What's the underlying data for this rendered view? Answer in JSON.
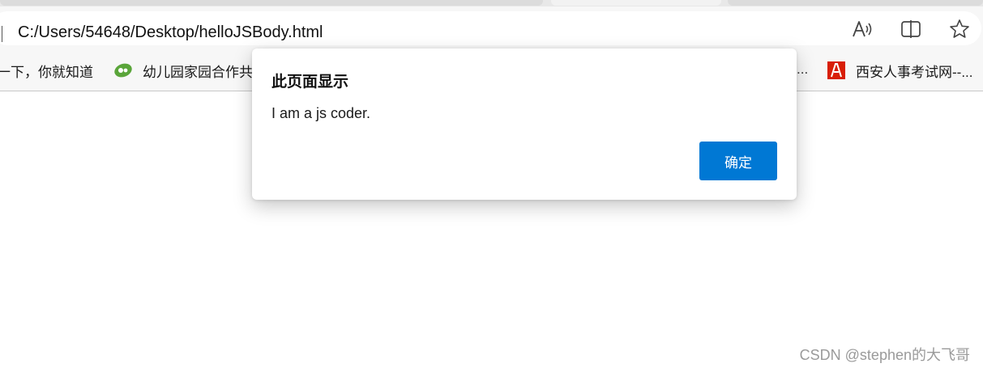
{
  "browser": {
    "address_bar": {
      "url": "C:/Users/54648/Desktop/helloJSBody.html"
    },
    "toolbar_icons": [
      "read-aloud-icon",
      "split-screen-icon",
      "favorite-star-icon"
    ],
    "favorites": [
      {
        "label": "一下，你就知道",
        "icon": "none"
      },
      {
        "label": "幼儿园家园合作共",
        "icon": "leaf-logo-icon"
      },
      {
        "label": "西安人事考试网--...",
        "icon": "red-logo-icon"
      }
    ],
    "favorites_overflow": "..."
  },
  "dialog": {
    "title": "此页面显示",
    "message": "I am a js coder.",
    "ok_label": "确定",
    "accent_color": "#0078d4"
  },
  "watermark": "CSDN @stephen的大飞哥"
}
